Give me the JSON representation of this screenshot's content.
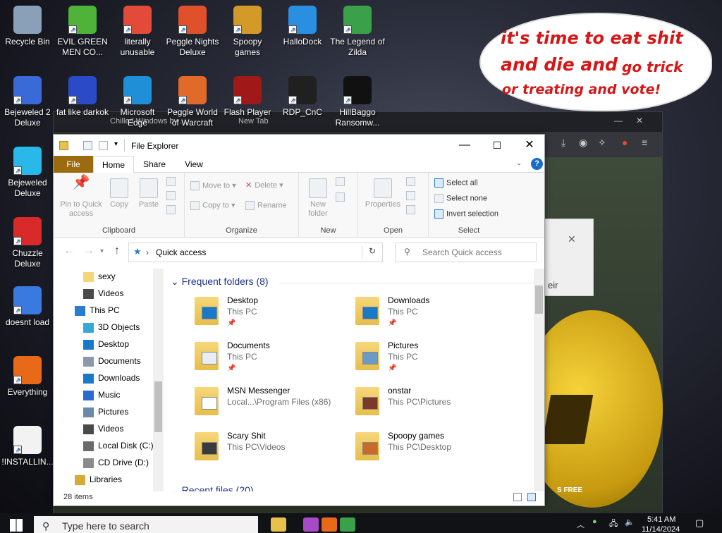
{
  "background_browser": {
    "tabs": [
      "Chilled Windows by ...",
      "New Tab"
    ],
    "panel_text": "eir",
    "free_text": "S   FREE"
  },
  "meme_bubble": {
    "line1": "it's time to eat shit",
    "line2_big": "and die and",
    "line2_small": "go trick",
    "line3": "or treating and vote!"
  },
  "desktop": {
    "icons": [
      {
        "label": "Recycle Bin",
        "color": "#8aa0b8"
      },
      {
        "label": "EVIL GREEN MEN CO...",
        "color": "#4fb33a"
      },
      {
        "label": "literally unusable",
        "color": "#e24b3a"
      },
      {
        "label": "Peggle Nights Deluxe",
        "color": "#e0502a"
      },
      {
        "label": "Spoopy games",
        "color": "#d39a2a"
      },
      {
        "label": "HalloDock",
        "color": "#2a8fe0"
      },
      {
        "label": "The Legend of Zilda",
        "color": "#3aa04a"
      },
      {
        "label": "Bejeweled 2 Deluxe",
        "color": "#3a6ad8"
      },
      {
        "label": "fat like darkok",
        "color": "#2a4ac8"
      },
      {
        "label": "Microsoft Edge",
        "color": "#1f8fd8"
      },
      {
        "label": "Peggle World of Warcraft",
        "color": "#e06a2a"
      },
      {
        "label": "Flash Player",
        "color": "#a01818"
      },
      {
        "label": "RDP_CnC",
        "color": "#202020"
      },
      {
        "label": "HillBaggo Ransomw...",
        "color": "#111111"
      },
      {
        "label": "Bejeweled Deluxe",
        "color": "#2ab8e8"
      },
      {
        "label": "Chuzzle Deluxe",
        "color": "#d82a2a"
      },
      {
        "label": "doesnt load",
        "color": "#3a7ae0"
      },
      {
        "label": "Everything",
        "color": "#e86a18"
      },
      {
        "label": "!INSTALLIN...",
        "color": "#f2f2f2"
      }
    ]
  },
  "explorer": {
    "title": "File Explorer",
    "ribbon_tabs": {
      "file": "File",
      "home": "Home",
      "share": "Share",
      "view": "View"
    },
    "ribbon": {
      "pin": "Pin to Quick access",
      "copy": "Copy",
      "paste": "Paste",
      "clipboard": "Clipboard",
      "move_to": "Move to",
      "copy_to": "Copy to",
      "delete": "Delete",
      "rename": "Rename",
      "organize": "Organize",
      "new_folder": "New folder",
      "new": "New",
      "properties": "Properties",
      "open": "Open",
      "select_all": "Select all",
      "select_none": "Select none",
      "invert_selection": "Invert selection",
      "select": "Select"
    },
    "address": {
      "star": "★",
      "path": "Quick access",
      "refresh": "↻"
    },
    "search_placeholder": "Search Quick access",
    "nav_pane": [
      {
        "label": "sexy",
        "icon": "folder-icon",
        "color": "#f3d57a"
      },
      {
        "label": "Videos",
        "icon": "videos-icon",
        "color": "#4a4a4a"
      },
      {
        "label": "This PC",
        "icon": "pc-icon",
        "color": "#2a7cd1"
      },
      {
        "label": "3D Objects",
        "icon": "3d-objects-icon",
        "color": "#39a8d8"
      },
      {
        "label": "Desktop",
        "icon": "desktop-icon",
        "color": "#1a78c8"
      },
      {
        "label": "Documents",
        "icon": "documents-icon",
        "color": "#8a9aa8"
      },
      {
        "label": "Downloads",
        "icon": "downloads-icon",
        "color": "#1a78c8"
      },
      {
        "label": "Music",
        "icon": "music-icon",
        "color": "#2a6ad0"
      },
      {
        "label": "Pictures",
        "icon": "pictures-icon",
        "color": "#6a8aa8"
      },
      {
        "label": "Videos",
        "icon": "videos-icon",
        "color": "#4a4a4a"
      },
      {
        "label": "Local Disk (C:)",
        "icon": "disk-icon",
        "color": "#6a6a6a"
      },
      {
        "label": "CD Drive (D:)",
        "icon": "cd-drive-icon",
        "color": "#8a8a8a"
      },
      {
        "label": "Libraries",
        "icon": "libraries-icon",
        "color": "#d8a83a"
      }
    ],
    "frequent_header": "Frequent folders (8)",
    "recent_header": "Recent files (20)",
    "folders": [
      {
        "name": "Desktop",
        "path": "This PC",
        "pinned": true,
        "badge": "#1a78c8"
      },
      {
        "name": "Downloads",
        "path": "This PC",
        "pinned": true,
        "badge": "#1a78c8"
      },
      {
        "name": "Documents",
        "path": "This PC",
        "pinned": true,
        "badge": "#e8eef4"
      },
      {
        "name": "Pictures",
        "path": "This PC",
        "pinned": true,
        "badge": "#6a9ac8"
      },
      {
        "name": "MSN Messenger",
        "path": "Local...\\Program Files (x86)",
        "pinned": false,
        "badge": "#ffffff"
      },
      {
        "name": "onstar",
        "path": "This PC\\Pictures",
        "pinned": false,
        "badge": "#7a3a2a"
      },
      {
        "name": "Scary Shit",
        "path": "This PC\\Videos",
        "pinned": false,
        "badge": "#3a3a3a"
      },
      {
        "name": "Spoopy games",
        "path": "This PC\\Desktop",
        "pinned": false,
        "badge": "#c86a2a"
      }
    ],
    "status": "28 items"
  },
  "taskbar": {
    "search_placeholder": "Type here to search",
    "time": "5:41 AM",
    "date": "11/14/2024"
  }
}
